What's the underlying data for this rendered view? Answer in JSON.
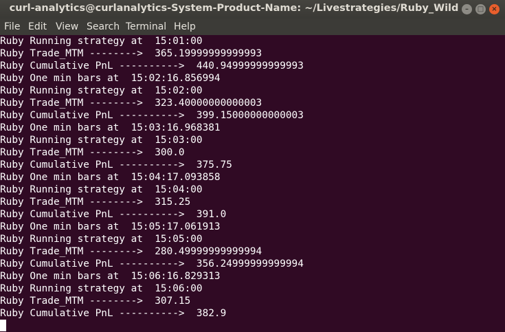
{
  "window": {
    "title": "curl-analytics@curlanalytics-System-Product-Name: ~/Livestrategies/Ruby_Wild",
    "controls": {
      "minimize": "–",
      "maximize": "□",
      "close": "×"
    }
  },
  "menu": {
    "items": [
      "File",
      "Edit",
      "View",
      "Search",
      "Terminal",
      "Help"
    ]
  },
  "terminal": {
    "lines": [
      "Ruby Running strategy at  15:01:00",
      "Ruby Trade_MTM -------->  365.19999999999993",
      "Ruby Cumulative PnL ---------->  440.94999999999993",
      "Ruby One min bars at  15:02:16.856994",
      "Ruby Running strategy at  15:02:00",
      "Ruby Trade_MTM -------->  323.40000000000003",
      "Ruby Cumulative PnL ---------->  399.15000000000003",
      "Ruby One min bars at  15:03:16.968381",
      "Ruby Running strategy at  15:03:00",
      "Ruby Trade_MTM -------->  300.0",
      "Ruby Cumulative PnL ---------->  375.75",
      "Ruby One min bars at  15:04:17.093858",
      "Ruby Running strategy at  15:04:00",
      "Ruby Trade_MTM -------->  315.25",
      "Ruby Cumulative PnL ---------->  391.0",
      "Ruby One min bars at  15:05:17.061913",
      "Ruby Running strategy at  15:05:00",
      "Ruby Trade_MTM -------->  280.49999999999994",
      "Ruby Cumulative PnL ---------->  356.24999999999994",
      "Ruby One min bars at  15:06:16.829313",
      "Ruby Running strategy at  15:06:00",
      "Ruby Trade_MTM -------->  307.15",
      "Ruby Cumulative PnL ---------->  382.9"
    ]
  }
}
